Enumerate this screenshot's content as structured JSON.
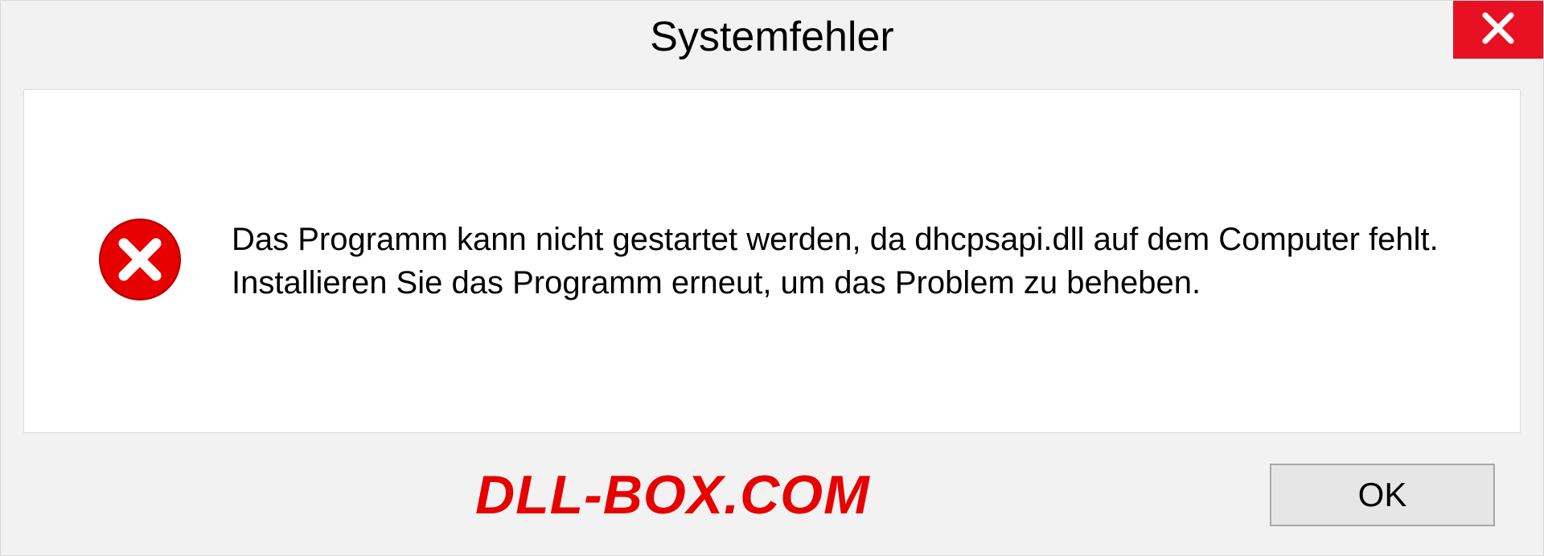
{
  "dialog": {
    "title": "Systemfehler",
    "message": "Das Programm kann nicht gestartet werden, da dhcpsapi.dll auf dem Computer fehlt. Installieren Sie das Programm erneut, um das Problem zu beheben.",
    "ok_label": "OK"
  },
  "watermark": "DLL-BOX.COM",
  "colors": {
    "close_bg": "#e81123",
    "error_icon": "#e60000",
    "watermark": "#e60000"
  }
}
